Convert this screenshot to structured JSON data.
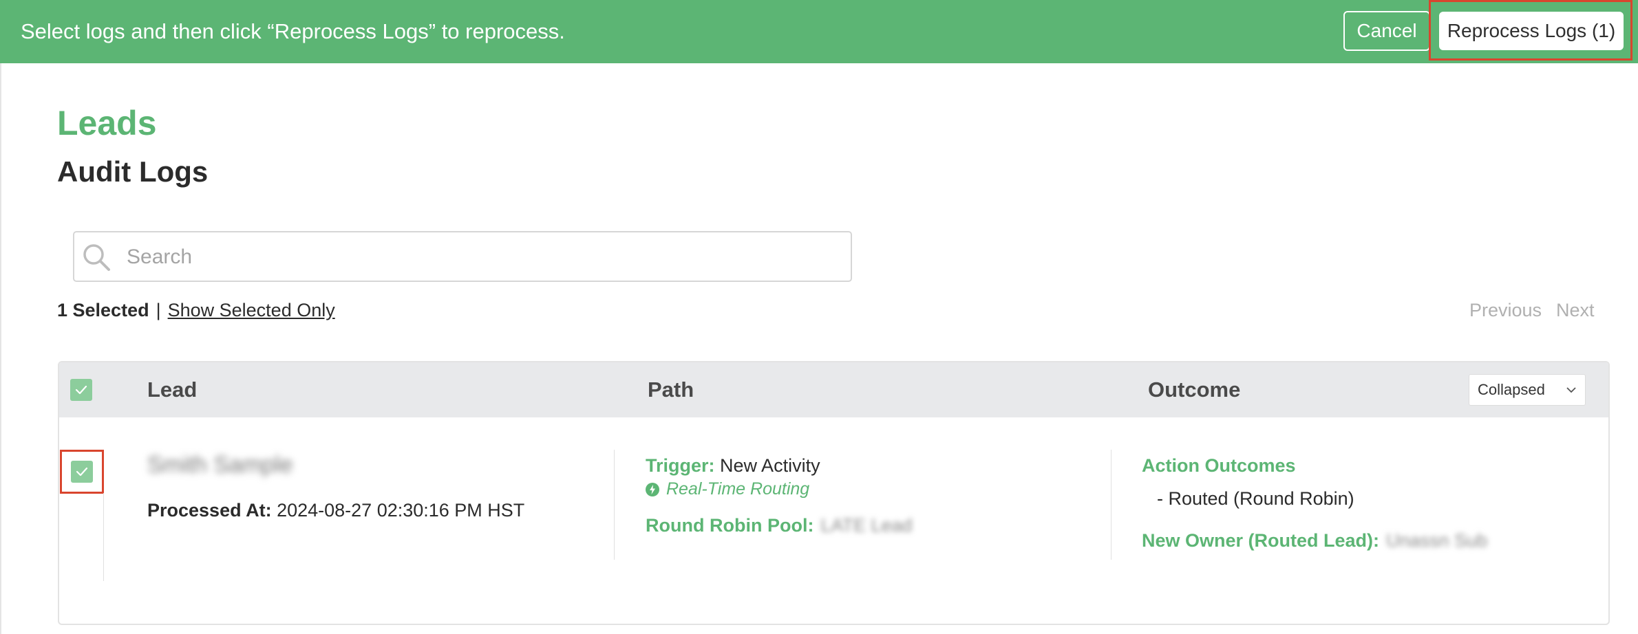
{
  "banner": {
    "message": "Select logs and then click “Reprocess Logs” to reprocess.",
    "cancel_label": "Cancel",
    "reprocess_label": "Reprocess Logs (1)"
  },
  "header": {
    "title": "Leads",
    "subtitle": "Audit Logs"
  },
  "search": {
    "placeholder": "Search",
    "value": ""
  },
  "selection": {
    "count_label": "1 Selected",
    "separator": "|",
    "show_selected_label": "Show Selected Only"
  },
  "pager": {
    "previous_label": "Previous",
    "next_label": "Next"
  },
  "table": {
    "columns": [
      "Lead",
      "Path",
      "Outcome"
    ],
    "view_select": {
      "selected": "Collapsed"
    },
    "rows": [
      {
        "checked": true,
        "lead_name": "Smith Sample",
        "processed_label": "Processed At:",
        "processed_value": "2024-08-27 02:30:16 PM HST",
        "trigger_label": "Trigger:",
        "trigger_value": "New Activity",
        "routing_mode": "Real-Time Routing",
        "pool_label": "Round Robin Pool:",
        "pool_value": "LATE Lead",
        "outcomes_title": "Action Outcomes",
        "outcome_item": "- Routed (Round Robin)",
        "owner_label": "New Owner (Routed Lead):",
        "owner_value": "Unassn Sub"
      }
    ]
  },
  "colors": {
    "brand_green": "#5cb574",
    "checkbox_green": "#8ccd9c",
    "highlight_red": "#d9452e",
    "header_bg": "#e8e9eb"
  }
}
